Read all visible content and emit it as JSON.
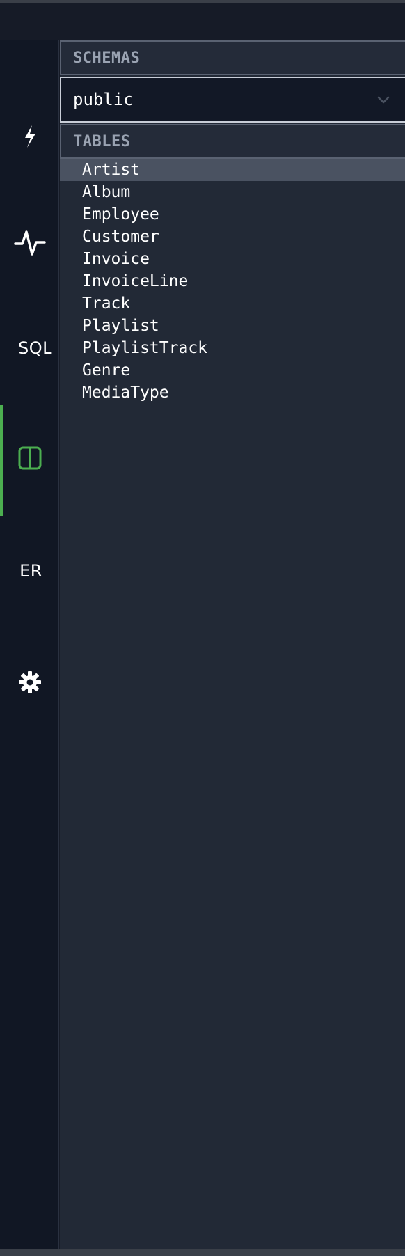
{
  "rail": {
    "items": [
      {
        "name": "connect",
        "icon": "lightning-icon"
      },
      {
        "name": "activity",
        "icon": "activity-icon"
      },
      {
        "name": "sql",
        "label": "SQL"
      },
      {
        "name": "browser",
        "icon": "columns-icon",
        "active": true
      },
      {
        "name": "er",
        "label": "ER"
      },
      {
        "name": "settings",
        "icon": "gear-icon"
      }
    ],
    "accent_color": "#4caf50"
  },
  "schemas": {
    "header": "SCHEMAS",
    "selected": "public"
  },
  "tables": {
    "header": "TABLES",
    "selected": "Artist",
    "items": [
      "Artist",
      "Album",
      "Employee",
      "Customer",
      "Invoice",
      "InvoiceLine",
      "Track",
      "Playlist",
      "PlaylistTrack",
      "Genre",
      "MediaType"
    ]
  }
}
